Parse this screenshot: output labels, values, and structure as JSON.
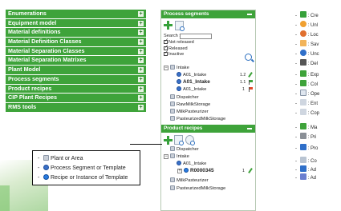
{
  "menu": {
    "items": [
      {
        "label": "Enumerations"
      },
      {
        "label": "Equipment model"
      },
      {
        "label": "Material definitions"
      },
      {
        "label": "Material Definition Classes"
      },
      {
        "label": "Material Separation Classes"
      },
      {
        "label": "Material Separation Matrixes"
      },
      {
        "label": "Plant Model"
      },
      {
        "label": "Process segments"
      },
      {
        "label": "Product recipes"
      },
      {
        "label": "CIP Plant Recipes"
      },
      {
        "label": "RMS tools"
      }
    ],
    "expander_symbol": "+"
  },
  "process_segments_panel": {
    "title": "Process segments",
    "search_label": "Search :",
    "search_value": "",
    "filters": [
      {
        "label": "Not released",
        "checked": true
      },
      {
        "label": "Released",
        "checked": true
      },
      {
        "label": "Inactive",
        "checked": true
      }
    ],
    "tree": {
      "root": "Intake",
      "children": [
        {
          "label": "A01_Intake",
          "version": "1.2",
          "icon": "pencil-icon"
        },
        {
          "label": "A01_Intake",
          "version": "1.1",
          "icon": "green-flag-icon",
          "bold": true
        },
        {
          "label": "A01_Intake",
          "version": "1",
          "icon": "red-flag-icon"
        }
      ],
      "others": [
        "Dispatcher",
        "RawMilkStorage",
        "MilkPasteurizer",
        "PasteurizedMilkStorage"
      ]
    }
  },
  "product_recipes_panel": {
    "title": "Product recipes",
    "tree": {
      "items": [
        "Dispatcher",
        "Intake",
        "A01_Intake"
      ],
      "recipe": {
        "label": "R0000345",
        "version": "1"
      },
      "others": [
        "MilkPasteurizer",
        "PasteurizedMilkStorage"
      ]
    }
  },
  "legend": {
    "rows": [
      {
        "dash": "-",
        "label": "Plant or Area"
      },
      {
        "dash": "-",
        "label": "Process Segment or Template"
      },
      {
        "dash": "-",
        "label": "Recipe or Instance of Template"
      }
    ]
  },
  "right_legend": {
    "items": [
      {
        "label": ": Cre"
      },
      {
        "label": ": Unl"
      },
      {
        "label": ": Loc"
      },
      {
        "label": ": Sav"
      },
      {
        "label": ": Unc"
      },
      {
        "label": ": Del"
      },
      {
        "label": ": Exp"
      },
      {
        "label": ": Col"
      },
      {
        "label": ": Ope"
      },
      {
        "label": ": Ent"
      },
      {
        "label": ": Cop"
      },
      {
        "label": ": Ma"
      },
      {
        "label": ": Pri"
      },
      {
        "label": ": Pro"
      },
      {
        "label": ": Co"
      },
      {
        "label": ": Ad"
      },
      {
        "label": ": Ad"
      }
    ]
  },
  "colors": {
    "menu_green": "#3ea33a",
    "panel_border": "#b7c9b3"
  }
}
